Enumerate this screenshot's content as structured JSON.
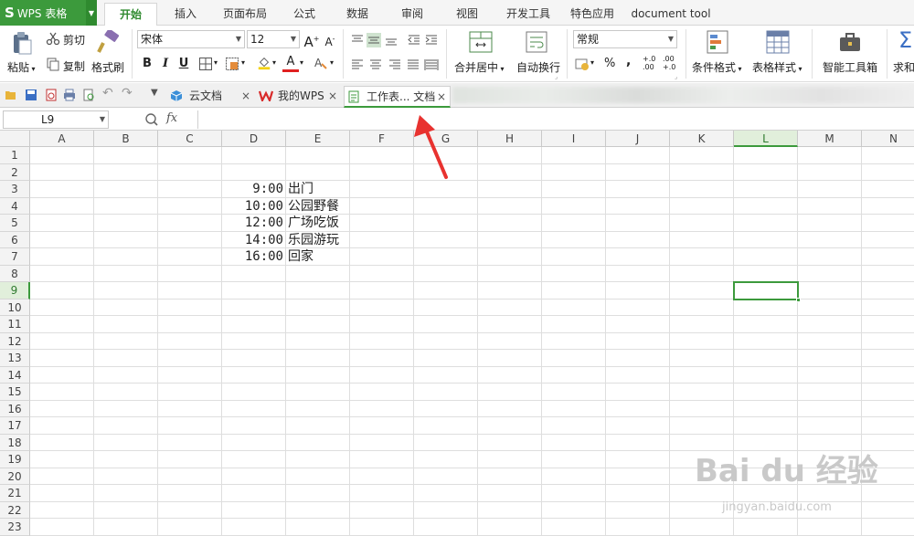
{
  "app": {
    "name": "WPS 表格",
    "logo": "S"
  },
  "menu": {
    "tabs": [
      "开始",
      "插入",
      "页面布局",
      "公式",
      "数据",
      "审阅",
      "视图",
      "开发工具",
      "特色应用",
      "document tool"
    ],
    "active": "开始"
  },
  "ribbon": {
    "paste": "粘贴",
    "cut": "剪切",
    "copy": "复制",
    "format_painter": "格式刷",
    "font_name": "宋体",
    "font_size": "12",
    "merge_center": "合并居中",
    "wrap_text": "自动换行",
    "number_format": "常规",
    "percent": "%",
    "comma": ",",
    "inc_decimal": "+.0 .00",
    "dec_decimal": ".00 +.0",
    "conditional_format": "条件格式",
    "table_style": "表格样式",
    "smart_toolbox": "智能工具箱",
    "sum": "求和",
    "bold": "B",
    "italic": "I",
    "underline": "U",
    "font_color": "A"
  },
  "doc_tabs": [
    {
      "label": "云文档",
      "icon": "cloud-cube-icon"
    },
    {
      "label": "我的WPS",
      "icon": "wps-logo-icon"
    },
    {
      "label": "工作表... 文档",
      "icon": "sheet-doc-icon",
      "active": true
    }
  ],
  "formula_bar": {
    "name_box": "L9",
    "fx": "fx",
    "content": ""
  },
  "sheet": {
    "columns": [
      "A",
      "B",
      "C",
      "D",
      "E",
      "F",
      "G",
      "H",
      "I",
      "J",
      "K",
      "L",
      "M",
      "N"
    ],
    "selected_column": "L",
    "rows": [
      "1",
      "2",
      "3",
      "4",
      "5",
      "6",
      "7",
      "8",
      "9",
      "10",
      "11",
      "12",
      "13",
      "14",
      "15",
      "16",
      "17",
      "18",
      "19",
      "20",
      "21",
      "22",
      "23"
    ],
    "selected_row": "9",
    "entries": [
      {
        "time": "9:00",
        "activity": "出门"
      },
      {
        "time": "10:00",
        "activity": "公园野餐"
      },
      {
        "time": "12:00",
        "activity": "广场吃饭"
      },
      {
        "time": "14:00",
        "activity": "乐园游玩"
      },
      {
        "time": "16:00",
        "activity": "回家"
      }
    ]
  },
  "watermark": {
    "brand": "Bai du 经验",
    "url": "jingyan.baidu.com"
  },
  "colors": {
    "accent": "#3c9a3c",
    "arrow": "#e8322f"
  }
}
